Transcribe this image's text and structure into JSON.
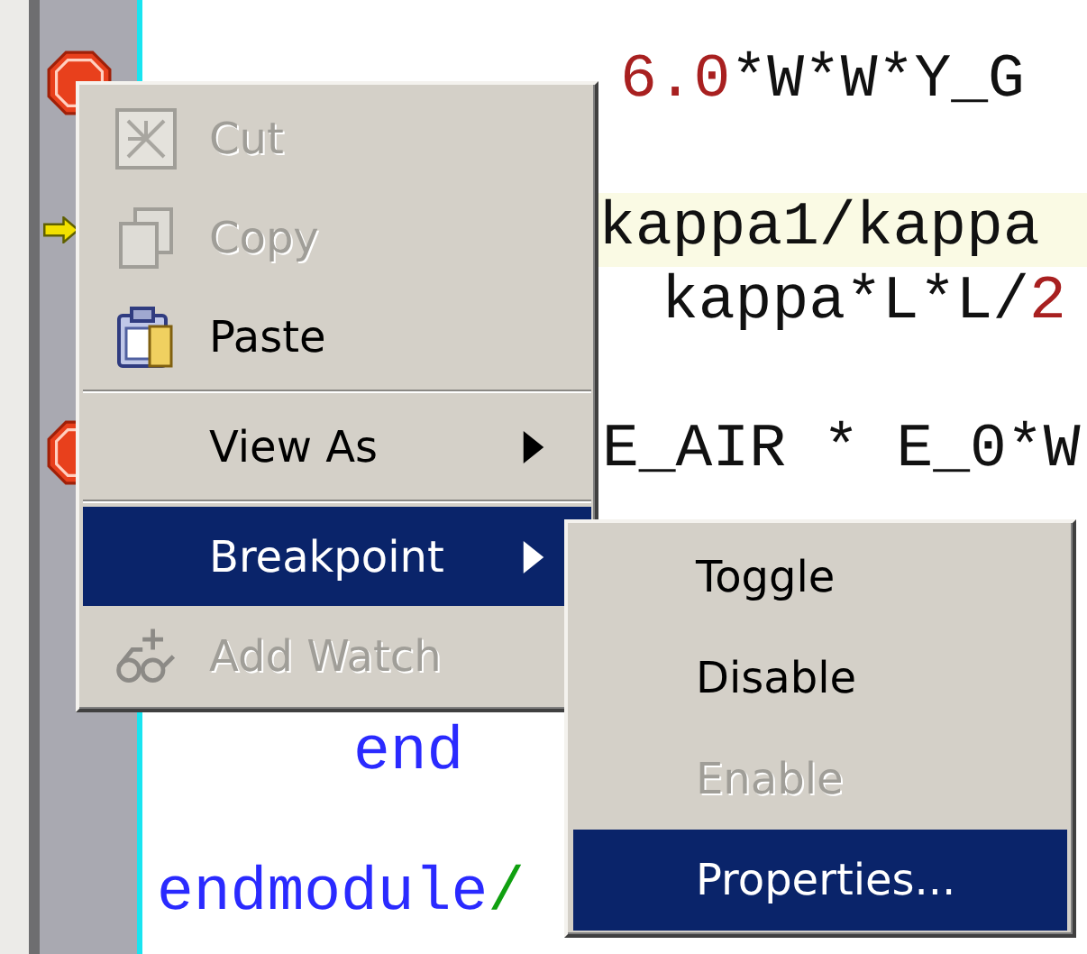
{
  "editor": {
    "lines": [
      {
        "breakpoint": true,
        "current": false,
        "segments": [
          {
            "text": "6.0",
            "kind": "number"
          },
          {
            "text": "*W*W*Y_G",
            "kind": "plain"
          }
        ]
      },
      {
        "breakpoint": false,
        "current": true,
        "segments": [
          {
            "text": "kappa1/kappa",
            "kind": "plain"
          }
        ]
      },
      {
        "breakpoint": false,
        "current": false,
        "segments": [
          {
            "text": "kappa*L*L/",
            "kind": "plain"
          },
          {
            "text": "2",
            "kind": "number"
          }
        ]
      },
      {
        "breakpoint": true,
        "current": false,
        "segments": [
          {
            "text": "E_AIR * E_0*W",
            "kind": "plain"
          }
        ]
      },
      {
        "breakpoint": false,
        "current": false,
        "segments": [
          {
            "text": "end",
            "kind": "keyword"
          }
        ]
      },
      {
        "breakpoint": false,
        "current": false,
        "segments": [
          {
            "text": "endmodule",
            "kind": "keyword"
          },
          {
            "text": "/",
            "kind": "comment"
          }
        ]
      }
    ]
  },
  "context_menu": {
    "items": [
      {
        "kind": "item",
        "label": "Cut",
        "disabled": true,
        "submenu": false,
        "selected": false
      },
      {
        "kind": "item",
        "label": "Copy",
        "disabled": true,
        "submenu": false,
        "selected": false
      },
      {
        "kind": "item",
        "label": "Paste",
        "disabled": false,
        "submenu": false,
        "selected": false
      },
      {
        "kind": "separator"
      },
      {
        "kind": "item",
        "label": "View As",
        "disabled": false,
        "submenu": true,
        "selected": false
      },
      {
        "kind": "separator"
      },
      {
        "kind": "item",
        "label": "Breakpoint",
        "disabled": false,
        "submenu": true,
        "selected": true
      },
      {
        "kind": "item",
        "label": "Add Watch",
        "disabled": true,
        "submenu": false,
        "selected": false
      }
    ]
  },
  "submenu": {
    "items": [
      {
        "label": "Toggle",
        "disabled": false,
        "selected": false
      },
      {
        "label": "Disable",
        "disabled": false,
        "selected": false
      },
      {
        "label": "Enable",
        "disabled": true,
        "selected": false
      },
      {
        "label": "Properties...",
        "disabled": false,
        "selected": true
      }
    ]
  }
}
